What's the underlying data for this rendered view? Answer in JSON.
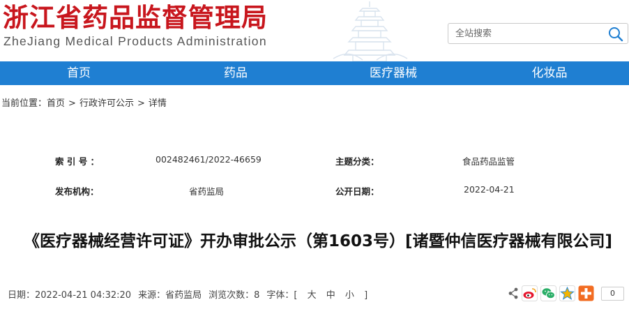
{
  "site": {
    "logo_cn": "浙江省药品监督管理局",
    "logo_en": "ZheJiang Medical Products Administration"
  },
  "search": {
    "placeholder": "全站搜索",
    "icon": "search-icon"
  },
  "nav": {
    "items": [
      {
        "label": "首页"
      },
      {
        "label": "药品"
      },
      {
        "label": "医疗器械"
      },
      {
        "label": "化妆品"
      }
    ]
  },
  "breadcrumb": {
    "prefix": "当前位置：",
    "items": [
      "首页",
      "行政许可公示",
      "详情"
    ],
    "separator": ">"
  },
  "meta": {
    "index_label": "索 引 号 ：",
    "index_value": "002482461/2022-46659",
    "topic_label": "主题分类：",
    "topic_value": "食品药品监管",
    "publisher_label": "发布机构：",
    "publisher_value": "省药监局",
    "date_label": "公开日期：",
    "date_value": "2022-04-21"
  },
  "article": {
    "title": "《医疗器械经营许可证》开办审批公示（第1603号）[诸暨仲信医疗器械有限公司]",
    "date": "日期：2022-04-21 04:32:20",
    "source": "来源：省药监局",
    "views": "浏览次数：8",
    "font_prefix": "字体：[",
    "font_large": "大",
    "font_medium": "中",
    "font_small": "小",
    "font_suffix": "]"
  },
  "share": {
    "count": "0",
    "icons": [
      "share-icon",
      "weibo-icon",
      "wechat-icon",
      "qzone-icon",
      "more-icon"
    ]
  },
  "colors": {
    "brand_red": "#c8161d",
    "nav_blue": "#1f7fd2"
  }
}
